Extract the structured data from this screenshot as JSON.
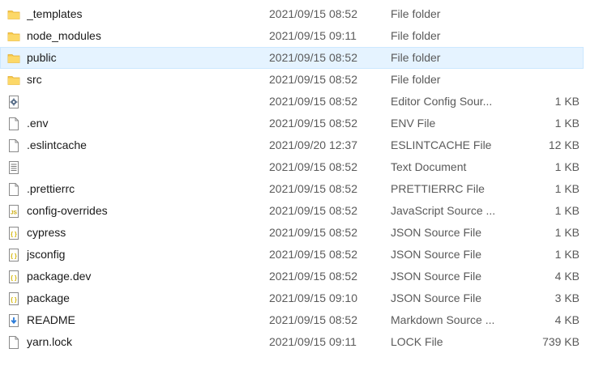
{
  "files": [
    {
      "name": "_templates",
      "date": "2021/09/15 08:52",
      "type": "File folder",
      "size": "",
      "icon": "folder-icon"
    },
    {
      "name": "node_modules",
      "date": "2021/09/15 09:11",
      "type": "File folder",
      "size": "",
      "icon": "folder-icon"
    },
    {
      "name": "public",
      "date": "2021/09/15 08:52",
      "type": "File folder",
      "size": "",
      "icon": "folder-icon",
      "selected": true
    },
    {
      "name": "src",
      "date": "2021/09/15 08:52",
      "type": "File folder",
      "size": "",
      "icon": "folder-icon"
    },
    {
      "name": "",
      "date": "2021/09/15 08:52",
      "type": "Editor Config Sour...",
      "size": "1 KB",
      "icon": "gear-file-icon"
    },
    {
      "name": ".env",
      "date": "2021/09/15 08:52",
      "type": "ENV File",
      "size": "1 KB",
      "icon": "blank-file-icon"
    },
    {
      "name": ".eslintcache",
      "date": "2021/09/20 12:37",
      "type": "ESLINTCACHE File",
      "size": "12 KB",
      "icon": "blank-file-icon"
    },
    {
      "name": "",
      "date": "2021/09/15 08:52",
      "type": "Text Document",
      "size": "1 KB",
      "icon": "text-file-icon"
    },
    {
      "name": ".prettierrc",
      "date": "2021/09/15 08:52",
      "type": "PRETTIERRC File",
      "size": "1 KB",
      "icon": "blank-file-icon"
    },
    {
      "name": "config-overrides",
      "date": "2021/09/15 08:52",
      "type": "JavaScript Source ...",
      "size": "1 KB",
      "icon": "js-file-icon"
    },
    {
      "name": "cypress",
      "date": "2021/09/15 08:52",
      "type": "JSON Source File",
      "size": "1 KB",
      "icon": "json-file-icon"
    },
    {
      "name": "jsconfig",
      "date": "2021/09/15 08:52",
      "type": "JSON Source File",
      "size": "1 KB",
      "icon": "json-file-icon"
    },
    {
      "name": "package.dev",
      "date": "2021/09/15 08:52",
      "type": "JSON Source File",
      "size": "4 KB",
      "icon": "json-file-icon"
    },
    {
      "name": "package",
      "date": "2021/09/15 09:10",
      "type": "JSON Source File",
      "size": "3 KB",
      "icon": "json-file-icon"
    },
    {
      "name": "README",
      "date": "2021/09/15 08:52",
      "type": "Markdown Source ...",
      "size": "4 KB",
      "icon": "markdown-file-icon"
    },
    {
      "name": "yarn.lock",
      "date": "2021/09/15 09:11",
      "type": "LOCK File",
      "size": "739 KB",
      "icon": "blank-file-icon"
    }
  ],
  "colors": {
    "folder": "#f8c948",
    "selection_bg": "#e5f3ff",
    "selection_border": "#cce8ff",
    "json_accent": "#d4b400",
    "markdown_accent": "#2b7bd8"
  }
}
